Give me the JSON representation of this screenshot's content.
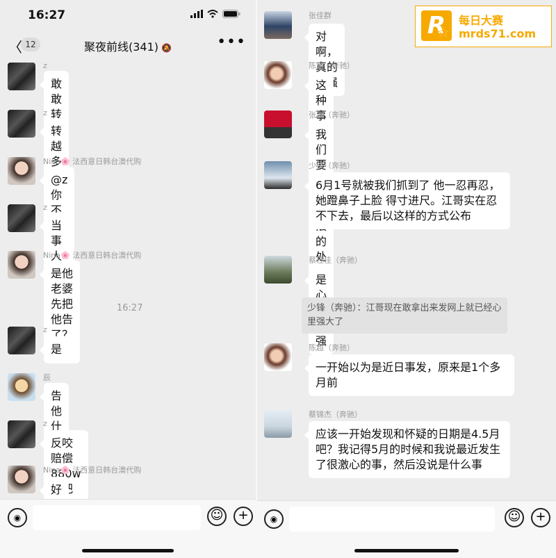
{
  "status": {
    "time": "16:27"
  },
  "nav": {
    "badge": "12",
    "title": "聚夜前线(341)"
  },
  "left_messages": [
    {
      "sender": "z",
      "text": "敢敢转"
    },
    {
      "sender": "z",
      "text": "转越多越好"
    },
    {
      "sender": "Nina🌸 法西意日韩台澳代购",
      "text": "@z 你不会是本人吧"
    },
    {
      "sender": "z",
      "text": "当事人让我发的"
    },
    {
      "sender": "Nina🌸 法西意日韩台澳代购",
      "text": "是他老婆先把他告了？@z"
    },
    {
      "sender": "z",
      "text": "是"
    },
    {
      "sender": "辰",
      "text": "告他什么"
    },
    {
      "sender": "z",
      "text": "反咬赔偿 880w 还把资产冻结了"
    },
    {
      "sender": "Nina🌸 法西意日韩台澳代购",
      "text": "好离谱"
    }
  ],
  "timestamp": "16:27",
  "right_messages": [
    {
      "sender": "张佳群",
      "text": "对啊，真的很强"
    },
    {
      "sender": "陈超（奔驰）",
      "text": "这种事面头够热"
    },
    {
      "sender": "张江（奔驰）",
      "text": "我们要正规合法的处理任何事情"
    },
    {
      "sender": "少锋（奔驰）",
      "text": "6月1号就被我们抓到了 他一忍再忍，她蹬鼻子上脸 得寸进尺。江哥实在忍不下去，最后以这样的方式公布"
    },
    {
      "sender": "蔡桂佳（奔驰）",
      "text": "是心态好强"
    },
    {
      "sender": "陈超（奔驰）",
      "text": "一开始以为是近日事发，原来是1个多月前"
    },
    {
      "sender": "蔡锦杰（奔驰）",
      "text": "应该一开始发现和怀疑的日期是4.5月吧？我记得5月的时候和我说最近发生了很激心的事，然后没说是什么事"
    }
  ],
  "quote": "少锋（奔驰）：江哥现在敢拿出来发网上就已经心里强大了",
  "watermark": {
    "line1": "每日大赛",
    "line2": "mrds71.com",
    "mark": "R"
  }
}
